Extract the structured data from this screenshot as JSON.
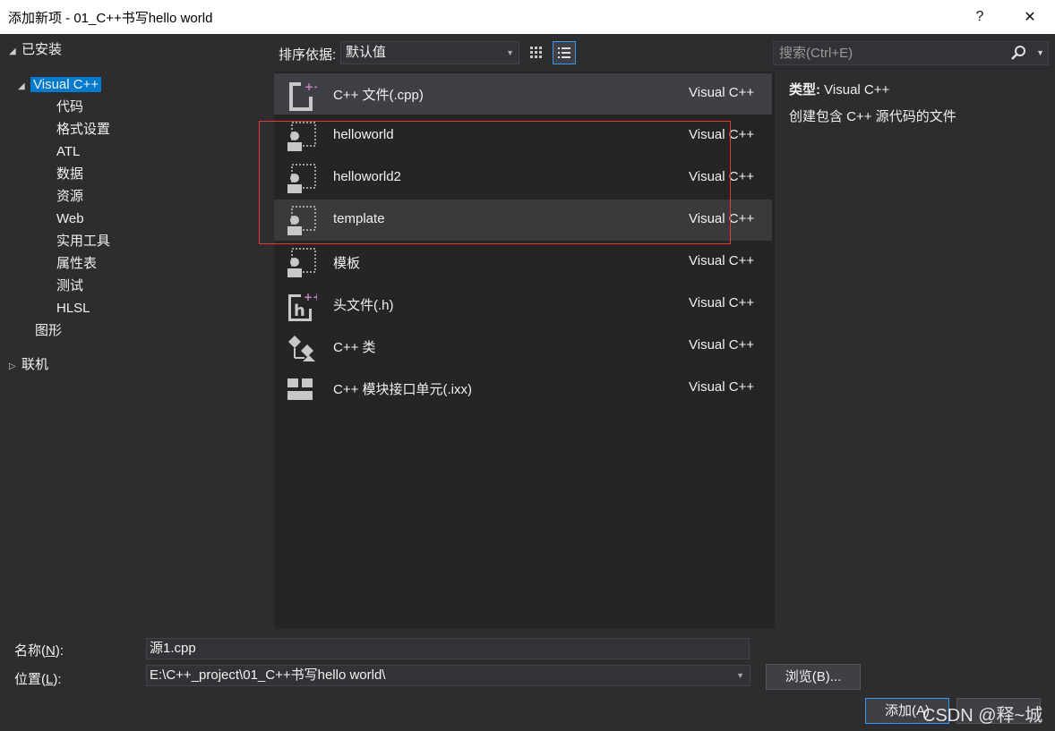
{
  "window": {
    "title": "添加新项 - 01_C++书写hello world",
    "help_label": "?",
    "close_label": "✕"
  },
  "tree": {
    "installed": "已安装",
    "visual_cpp": "Visual C++",
    "children": [
      "代码",
      "格式设置",
      "ATL",
      "数据",
      "资源",
      "Web",
      "实用工具",
      "属性表",
      "测试",
      "HLSL"
    ],
    "graphics": "图形",
    "online": "联机"
  },
  "toolbar": {
    "sort_label": "排序依据:",
    "sort_value": "默认值"
  },
  "search": {
    "placeholder": "搜索(Ctrl+E)"
  },
  "templates": [
    {
      "name": "C++ 文件(.cpp)",
      "type": "Visual C++",
      "icon": "cpp-file-icon"
    },
    {
      "name": "helloworld",
      "type": "Visual C++",
      "icon": "template-icon"
    },
    {
      "name": "helloworld2",
      "type": "Visual C++",
      "icon": "template-icon"
    },
    {
      "name": "template",
      "type": "Visual C++",
      "icon": "template-icon"
    },
    {
      "name": "模板",
      "type": "Visual C++",
      "icon": "template-icon"
    },
    {
      "name": "头文件(.h)",
      "type": "Visual C++",
      "icon": "header-file-icon"
    },
    {
      "name": "C++ 类",
      "type": "Visual C++",
      "icon": "class-icon"
    },
    {
      "name": "C++ 模块接口单元(.ixx)",
      "type": "Visual C++",
      "icon": "module-icon"
    }
  ],
  "details": {
    "type_label": "类型:",
    "type_value": "Visual C++",
    "description": "创建包含 C++ 源代码的文件"
  },
  "form": {
    "name_label_prefix": "名称(",
    "name_label_key": "N",
    "name_label_suffix": "):",
    "name_value": "源1.cpp",
    "location_label_prefix": "位置(",
    "location_label_key": "L",
    "location_label_suffix": "):",
    "location_value": "E:\\C++_project\\01_C++书写hello world\\",
    "browse_label": "浏览(B)...",
    "add_label": "添加(A)"
  },
  "watermark": "CSDN @释~城",
  "colors": {
    "accent": "#007acc",
    "highlight_box": "#e53935",
    "background": "#2d2d30"
  }
}
